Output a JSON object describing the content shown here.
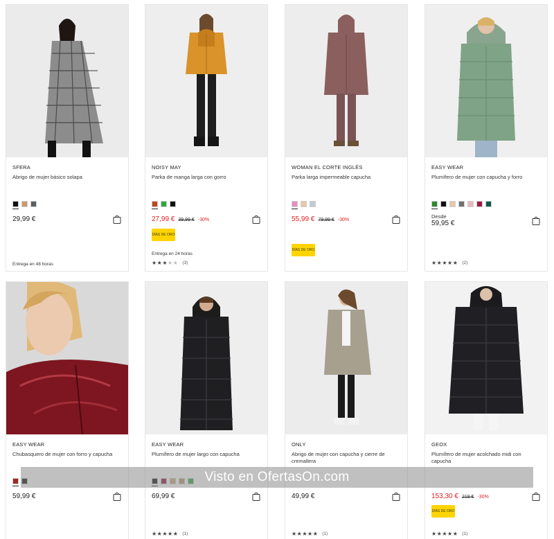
{
  "products": [
    {
      "brand": "SFERA",
      "name": "Abrigo de mujer básico solapa",
      "swatches": [
        "#111111",
        "#c9996b",
        "#5b6066"
      ],
      "price": "29,99 €",
      "delivery": "Entrega en 48 horas",
      "icon": "shopping-bag-icon"
    },
    {
      "brand": "NOISY MAY",
      "name": "Parka de manga larga con gorro",
      "swatches": [
        "#c2461e",
        "#2aa841",
        "#111111"
      ],
      "price": "27,99 €",
      "old_price": "39,99 €",
      "discount": "-30%",
      "badge": "DÍAS DE ORO",
      "delivery": "Entrega en 24 horas",
      "rating_value": 3.5,
      "rating_count": "(3)",
      "icon": "shopping-bag-icon"
    },
    {
      "brand": "WOMAN EL CORTE INGLÉS",
      "name": "Parka larga impermeable capucha",
      "swatches": [
        "#e68fbd",
        "#e9c8a3",
        "#b9cdd8"
      ],
      "price": "55,99 €",
      "old_price": "79,99 €",
      "discount": "-30%",
      "badge": "DÍAS DE ORO",
      "icon": "shopping-bag-icon"
    },
    {
      "brand": "EASY WEAR",
      "name": "Plumífero de mujer con capucha y forro",
      "swatches": [
        "#2a8a2a",
        "#111111",
        "#e7c6a8",
        "#707070",
        "#e6b8c0",
        "#9a1c44",
        "#0f5a4a"
      ],
      "desde": "Desde",
      "price": "59,95 €",
      "rating_value": 5,
      "rating_count": "(2)",
      "icon": "shopping-bag-icon"
    },
    {
      "brand": "EASY WEAR",
      "name": "Chubasquero de mujer con forro y capucha",
      "swatches": [
        "#9b2a22",
        "#111111"
      ],
      "price": "59,99 €",
      "icon": "shopping-bag-icon"
    },
    {
      "brand": "EASY WEAR",
      "name": "Plumífero de mujer largo con capucha",
      "swatches": [
        "#111111",
        "#8b1a3a",
        "#c9a67a",
        "#b89a6a",
        "#2aa841"
      ],
      "price": "69,99 €",
      "rating_value": 5,
      "rating_count": "(1)",
      "icon": "shopping-bag-icon"
    },
    {
      "brand": "ONLY",
      "name": "Abrigo de mujer con capucha y cierre de cremallera",
      "swatches": [],
      "price": "49,99 €",
      "rating_value": 5,
      "rating_count": "(1)",
      "icon": "shopping-bag-icon"
    },
    {
      "brand": "GEOX",
      "name": "Plumífero de mujer acolchado midi con capucha",
      "swatches": [],
      "price": "153,30 €",
      "old_price": "219 €",
      "discount": "-30%",
      "badge": "DÍAS DE ORO",
      "rating_value": 5,
      "rating_count": "(1)",
      "icon": "shopping-bag-icon"
    }
  ],
  "watermark": "Visto en OfertasOn.com",
  "colors": {
    "sale_price": "#e02020",
    "badge": "#ffd400"
  }
}
